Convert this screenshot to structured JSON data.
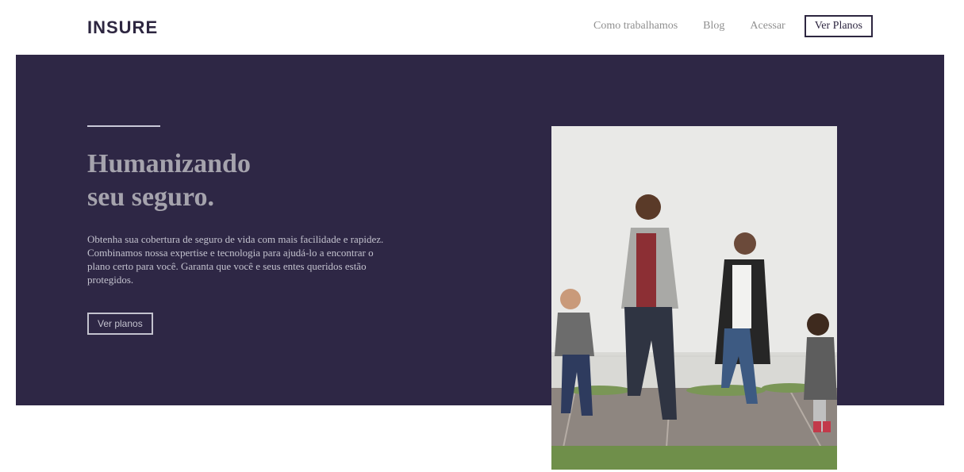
{
  "header": {
    "logo": "INSURE",
    "nav": [
      "Como trabalhamos",
      "Blog",
      "Acessar"
    ],
    "cta": "Ver Planos"
  },
  "hero": {
    "title_line1": "Humanizando",
    "title_line2": "seu seguro.",
    "text": "Obtenha sua cobertura de seguro de vida com mais facilidade e rapidez. Combinamos nossa expertise e tecnologia para ajudá-lo a encontrar o plano certo para você. Garanta que você e seus entes queridos estão protegidos.",
    "button": "Ver planos"
  },
  "colors": {
    "brand": "#2e2745",
    "muted_text": "#c3c2ce"
  }
}
